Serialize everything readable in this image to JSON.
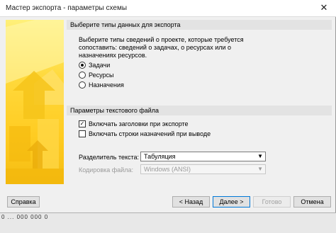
{
  "window": {
    "title": "Мастер экспорта - параметры схемы",
    "close_glyph": "✕"
  },
  "data_types": {
    "header": "Выберите типы данных для экспорта",
    "description_lines": [
      "Выберите типы сведений о проекте, которые требуется",
      "сопоставить: сведений о задачах, о ресурсах или о",
      "назначениях ресурсов."
    ],
    "options": [
      {
        "label": "Задачи",
        "checked": true
      },
      {
        "label": "Ресурсы",
        "checked": false
      },
      {
        "label": "Назначения",
        "checked": false
      }
    ]
  },
  "text_file": {
    "header": "Параметры текстового файла",
    "checkboxes": [
      {
        "label": "Включать заголовки при экспорте",
        "checked": true
      },
      {
        "label": "Включать строки назначений при выводе",
        "checked": false
      }
    ],
    "delimiter_label": "Разделитель текста:",
    "delimiter_value": "Табуляция",
    "encoding_label": "Кодировка файла:",
    "encoding_value": "Windows (ANSI)"
  },
  "buttons": {
    "help": "Справка",
    "back": "< Назад",
    "next": "Далее >",
    "finish": "Готово",
    "cancel": "Отмена"
  },
  "status_bar": {
    "text": "0 ... 000 000 0"
  },
  "colors": {
    "accent_border": "#0078d7",
    "side_image": "#ffcc22"
  }
}
